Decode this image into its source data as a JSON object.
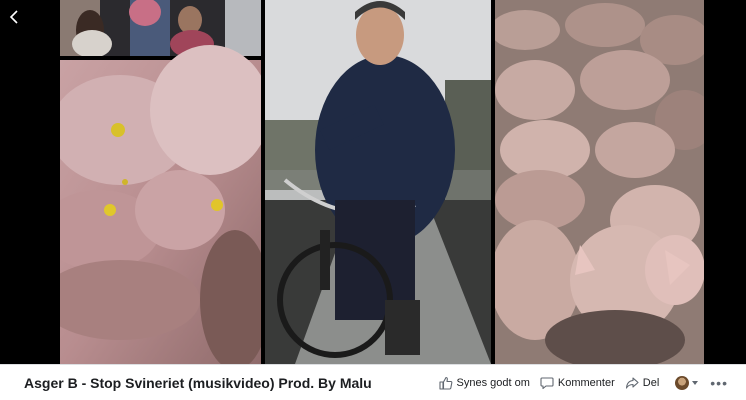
{
  "video": {
    "title": "Asger B - Stop Svineriet (musikvideo) Prod. By Malu"
  },
  "actions": {
    "like_label": "Synes godt om",
    "comment_label": "Kommenter",
    "share_label": "Del"
  },
  "icons": {
    "back": "chevron-left-icon",
    "like": "thumbs-up-icon",
    "comment": "speech-bubble-icon",
    "share": "share-arrow-icon",
    "more": "ellipsis-icon"
  },
  "colors": {
    "player_bg": "#000000",
    "bar_bg": "#ffffff",
    "text": "#1c1e21",
    "secondary": "#606770"
  }
}
